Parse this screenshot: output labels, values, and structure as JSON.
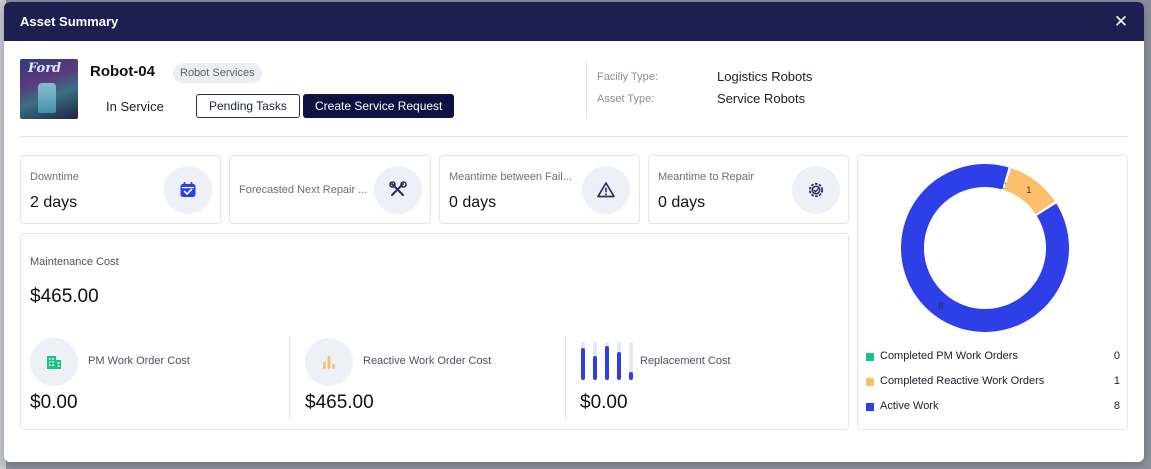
{
  "modal": {
    "title": "Asset Summary",
    "close_icon": "close-icon"
  },
  "asset": {
    "name": "Robot-04",
    "category": "Robot Services",
    "status": "In Service",
    "thumbnail_logo": "Ford",
    "pending_tasks_label": "Pending Tasks",
    "create_request_label": "Create Service Request",
    "facility_type_label": "Faciliy Type:",
    "facility_type_value": "Logistics Robots",
    "asset_type_label": "Asset Type:",
    "asset_type_value": "Service Robots"
  },
  "stats": [
    {
      "label": "Downtime",
      "value": "2 days",
      "icon": "calendar-check-icon"
    },
    {
      "label": "Forecasted Next Repair ...",
      "value": "",
      "icon": "tools-icon"
    },
    {
      "label": "Meantime between Fail...",
      "value": "0 days",
      "icon": "warning-icon"
    },
    {
      "label": "Meantime to Repair",
      "value": "0 days",
      "icon": "gear-repair-icon"
    }
  ],
  "maintenance": {
    "title": "Maintenance Cost",
    "total": "$465.00",
    "items": [
      {
        "label": "PM Work Order Cost",
        "value": "$0.00",
        "icon": "building-icon"
      },
      {
        "label": "Reactive Work Order Cost",
        "value": "$465.00",
        "icon": "bar-chart-icon"
      },
      {
        "label": "Replacement Cost",
        "value": "$0.00",
        "icon": "bars-progress-icon"
      }
    ]
  },
  "colors": {
    "header": "#1c1f4f",
    "accent_blue": "#2f3fe8",
    "orange": "#f9bf6b",
    "green": "#19c28b",
    "icon_bg": "#eef0f8"
  },
  "chart_data": {
    "type": "pie",
    "variant": "donut",
    "categories": [
      "Completed PM Work Orders",
      "Completed Reactive Work Orders",
      "Active Work"
    ],
    "values": [
      0,
      1,
      8
    ],
    "colors": [
      "#19c28b",
      "#f9bf6b",
      "#2f3fe8"
    ],
    "slice_labels": [
      "0",
      "1",
      "8"
    ],
    "legend": "bottom"
  }
}
